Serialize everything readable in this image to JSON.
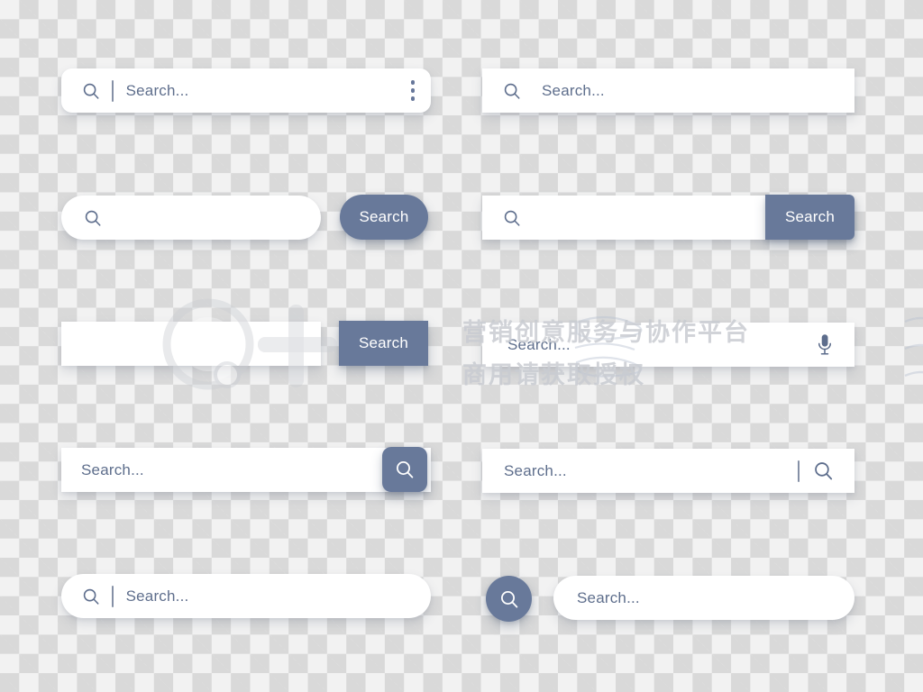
{
  "theme": {
    "accent": "#68799a",
    "placeholder_color": "#5e6e8c",
    "field_bg": "#ffffff",
    "canvas_checker_light": "#f2f2f2",
    "canvas_checker_dark": "#d9d9d9"
  },
  "watermark": {
    "line1": "营销创意服务与协作平台",
    "line2": "商用请获取授权"
  },
  "search_bars": [
    {
      "id": "rounded-with-menu",
      "placeholder": "Search...",
      "leading_icon": "search-icon",
      "divider": true,
      "trailing_icon": "more-vertical-icon",
      "shape": "rounded"
    },
    {
      "id": "square-plain",
      "placeholder": "Search...",
      "leading_icon": "search-icon",
      "divider": false,
      "shape": "square"
    },
    {
      "id": "pill-detached-button",
      "placeholder": "",
      "leading_icon": "search-icon",
      "button_label": "Search",
      "shape": "pill"
    },
    {
      "id": "square-attached-button",
      "placeholder": "",
      "leading_icon": "search-icon",
      "button_label": "Search",
      "shape": "square"
    },
    {
      "id": "square-detached-button",
      "placeholder": "",
      "leading_icon": "",
      "button_label": "Search",
      "shape": "square"
    },
    {
      "id": "square-with-microphone",
      "placeholder": "Search...",
      "trailing_icon": "microphone-icon",
      "shape": "square"
    },
    {
      "id": "square-with-icon-button",
      "placeholder": "Search...",
      "trailing_icon": "search-icon",
      "shape": "square"
    },
    {
      "id": "square-with-inline-icon",
      "placeholder": "Search...",
      "divider": true,
      "trailing_icon": "search-icon",
      "shape": "square"
    },
    {
      "id": "pill-with-leading-icon",
      "placeholder": "Search...",
      "leading_icon": "search-icon",
      "divider": true,
      "shape": "pill"
    },
    {
      "id": "pill-with-circle-button",
      "placeholder": "Search...",
      "leading_icon": "search-icon",
      "shape": "pill"
    }
  ]
}
